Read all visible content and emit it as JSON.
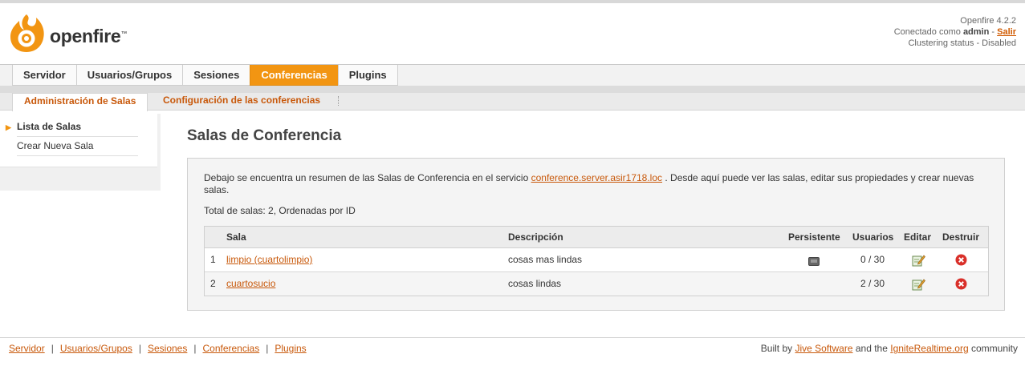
{
  "brand": {
    "name": "openfire",
    "tm": "™"
  },
  "header": {
    "version": "Openfire 4.2.2",
    "connected_prefix": "Conectado como",
    "user": "admin",
    "logout_sep": "-",
    "logout": "Salir",
    "clustering": "Clustering status - Disabled"
  },
  "tabs": [
    "Servidor",
    "Usuarios/Grupos",
    "Sesiones",
    "Conferencias",
    "Plugins"
  ],
  "subtabs": [
    "Administración de Salas",
    "Configuración de las conferencias"
  ],
  "sidebar": [
    "Lista de Salas",
    "Crear Nueva Sala"
  ],
  "page": {
    "title": "Salas de Conferencia",
    "intro_before": "Debajo se encuentra un resumen de las Salas de Conferencia en el servicio",
    "service": "conference.server.asir1718.loc",
    "intro_after": ". Desde aquí puede ver las salas, editar sus propiedades y crear nuevas salas.",
    "total": "Total de salas: 2, Ordenadas por ID"
  },
  "table": {
    "headers": [
      "Sala",
      "Descripción",
      "Persistente",
      "Usuarios",
      "Editar",
      "Destruir"
    ],
    "rows": [
      {
        "num": "1",
        "sala": "limpio (cuartolimpio)",
        "descripcion": "cosas mas lindas",
        "persistente": true,
        "usuarios": "0 / 30"
      },
      {
        "num": "2",
        "sala": "cuartosucio",
        "descripcion": "cosas lindas",
        "persistente": false,
        "usuarios": "2 / 30"
      }
    ]
  },
  "footer": {
    "links": [
      "Servidor",
      "Usuarios/Grupos",
      "Sesiones",
      "Conferencias",
      "Plugins"
    ],
    "built_by": "Built by",
    "jive": "Jive Software",
    "and_the": "and the",
    "ignite": "IgniteRealtime.org",
    "community": "community"
  },
  "colors": {
    "accent": "#f29512",
    "link": "#c8580a",
    "delete": "#d9302a"
  }
}
